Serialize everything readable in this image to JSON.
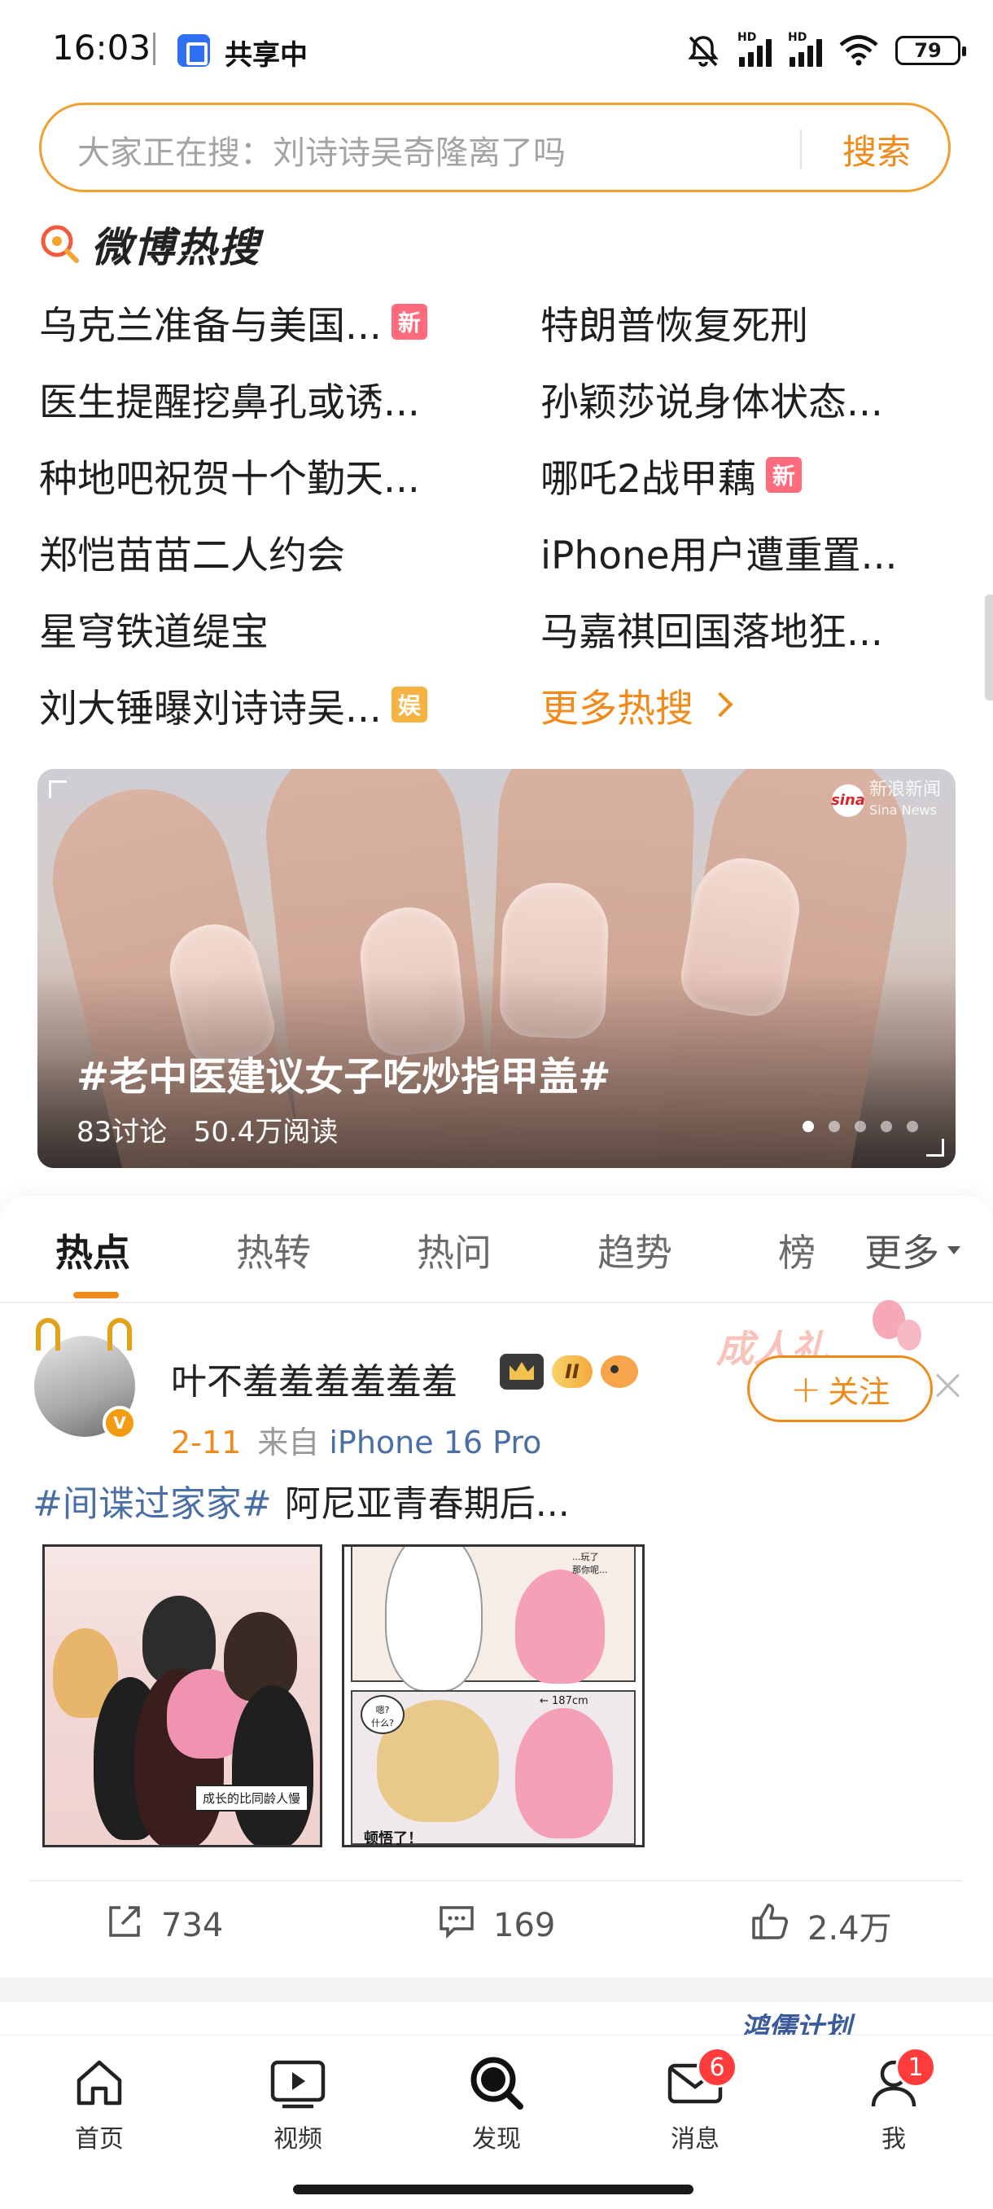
{
  "status_bar": {
    "time": "16:03",
    "share_label": "共享中",
    "network_label": "HD",
    "battery": "79"
  },
  "search": {
    "placeholder": "大家正在搜：刘诗诗吴奇隆离了吗",
    "button_label": "搜索"
  },
  "hot_search": {
    "brand": "微博热搜",
    "items": [
      {
        "text": "乌克兰准备与美国...",
        "badge": "新",
        "badge_type": "new"
      },
      {
        "text": "特朗普恢复死刑",
        "badge": "",
        "badge_type": ""
      },
      {
        "text": "医生提醒挖鼻孔或诱...",
        "badge": "",
        "badge_type": ""
      },
      {
        "text": "孙颖莎说身体状态...",
        "badge": "",
        "badge_type": ""
      },
      {
        "text": "种地吧祝贺十个勤天...",
        "badge": "",
        "badge_type": ""
      },
      {
        "text": "哪吒2战甲藕",
        "badge": "新",
        "badge_type": "new"
      },
      {
        "text": "郑恺苗苗二人约会",
        "badge": "",
        "badge_type": ""
      },
      {
        "text": "iPhone用户遭重置...",
        "badge": "",
        "badge_type": ""
      },
      {
        "text": "星穹铁道缇宝",
        "badge": "",
        "badge_type": ""
      },
      {
        "text": "马嘉祺回国落地狂...",
        "badge": "",
        "badge_type": ""
      },
      {
        "text": "刘大锤曝刘诗诗吴...",
        "badge": "娱",
        "badge_type": "ent"
      }
    ],
    "more_label": "更多热搜"
  },
  "banner": {
    "title": "#老中医建议女子吃炒指甲盖#",
    "discussions": "83讨论",
    "reads": "50.4万阅读",
    "logo_mark": "sina",
    "logo_text": "新浪新闻",
    "logo_sub": "Sina News",
    "dot_count": 5,
    "active_dot": 0
  },
  "tabs": {
    "items": [
      "热点",
      "热转",
      "热问",
      "趋势",
      "榜"
    ],
    "active": 0,
    "more_label": "更多"
  },
  "post": {
    "username": "叶不羞羞羞羞羞羞",
    "vip_level": "II",
    "verified_mark": "V",
    "date": "2-11",
    "source": "来自",
    "device": "iPhone 16 Pro",
    "topic": "#间谍过家家#",
    "text": "阿尼亚青春期后...",
    "promo_deco": "成人礼",
    "follow_label": "关注",
    "follow_plus": "+",
    "image1_caption": "成长的比同龄人慢",
    "image2_caption_1": "...玩了\n那你呢...",
    "image2_caption_2": "嗯?\n什么?",
    "image2_caption_3": "← 187cm",
    "image2_caption_4": "顿悟了！",
    "repost_count": "734",
    "comment_count": "169",
    "like_count": "2.4万"
  },
  "next_peek": "鸿儒计划",
  "bottom_nav": {
    "items": [
      {
        "label": "首页",
        "badge": ""
      },
      {
        "label": "视频",
        "badge": ""
      },
      {
        "label": "发现",
        "badge": ""
      },
      {
        "label": "消息",
        "badge": "6"
      },
      {
        "label": "我",
        "badge": "1"
      }
    ]
  },
  "colors": {
    "accent": "#f08a1a",
    "link": "#4a6fa5",
    "badge_new": "#ff6b7d",
    "badge_ent": "#f6b341",
    "nav_badge": "#ff3b3b"
  }
}
